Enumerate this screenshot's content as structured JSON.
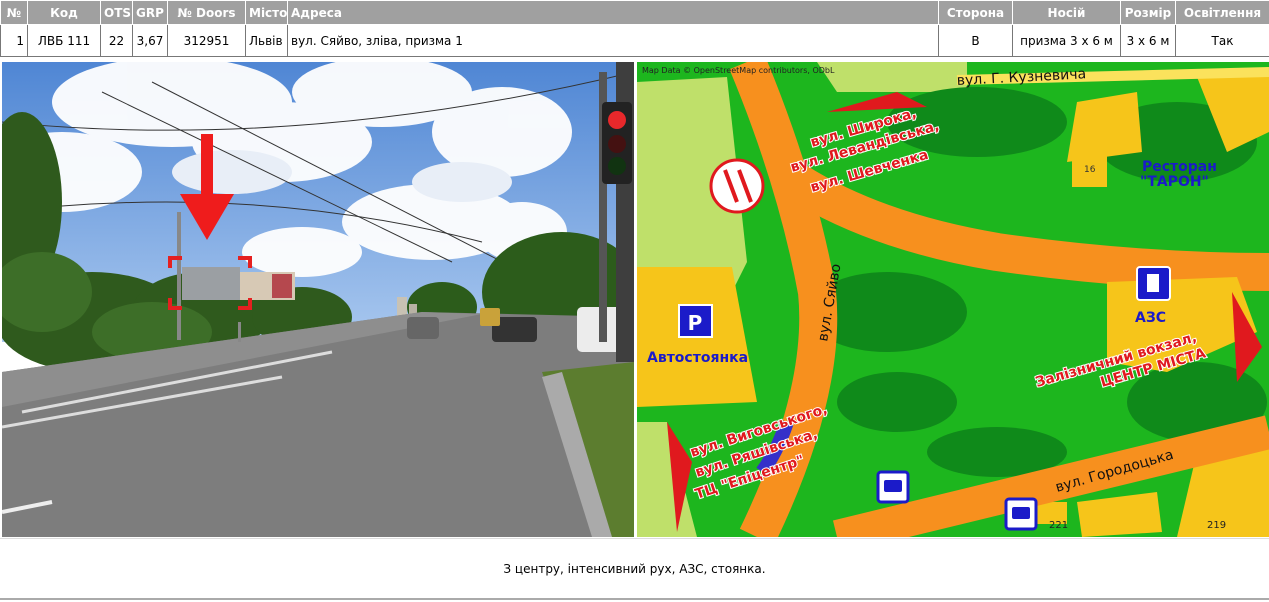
{
  "table": {
    "headers": {
      "num": "№",
      "code": "Код",
      "ots": "OTS",
      "grp": "GRP",
      "doors": "№ Doors",
      "city": "Місто",
      "address": "Адреса",
      "side": "Сторона",
      "carrier": "Носій",
      "size": "Розмір",
      "lighting": "Освітлення"
    },
    "row": {
      "num": "1",
      "code": "ЛВБ 111",
      "ots": "22",
      "grp": "3,67",
      "doors": "312951",
      "city": "Львів",
      "address": "вул. Сяйво, зліва, призма 1",
      "side": "В",
      "carrier": "призма 3 х 6 м",
      "size": "3 х 6 м",
      "lighting": "Так"
    }
  },
  "map": {
    "attribution": "Map Data © OpenStreetMap contributors, ODbL",
    "street_kuznevycha": "вул. Г. Кузневича",
    "direction_top_1": "вул. Широка,",
    "direction_top_2": "вул. Левандівська,",
    "direction_top_3": "вул. Шевченка",
    "restaurant_1": "Ресторан",
    "restaurant_2": "\"ТАРОН\"",
    "house_16": "16",
    "street_siaivo": "вул. Сяйво",
    "parking_label": "Автостоянка",
    "parking_icon": "P",
    "gas_station": "АЗС",
    "direction_right_1": "Залізничний вокзал,",
    "direction_right_2": "ЦЕНТР МІСТА",
    "direction_bottom_1": "вул. Виговського,",
    "direction_bottom_2": "вул. Ряшівська,",
    "direction_bottom_3": "ТЦ \"Епіцентр\"",
    "street_horodotska": "вул. Городоцька",
    "house_221": "221",
    "house_219": "219"
  },
  "description": "З центру, інтенсивний рух, АЗС, стоянка."
}
